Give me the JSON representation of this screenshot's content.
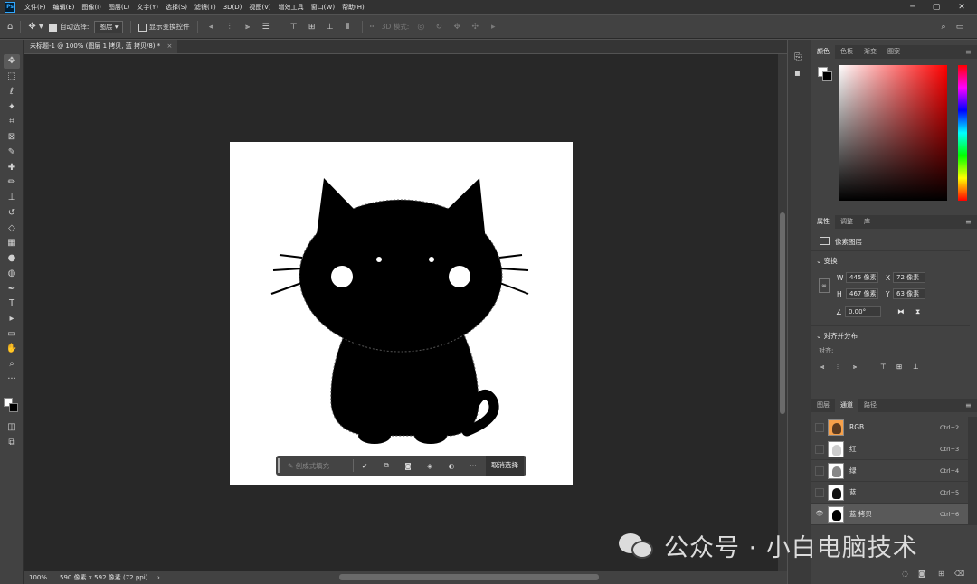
{
  "app": {
    "logo": "Ps",
    "menus": [
      "文件(F)",
      "编辑(E)",
      "图像(I)",
      "图层(L)",
      "文字(Y)",
      "选择(S)",
      "滤镜(T)",
      "3D(D)",
      "视图(V)",
      "增效工具",
      "窗口(W)",
      "帮助(H)"
    ]
  },
  "window": {
    "minimize": "─",
    "maximize": "▢",
    "close": "✕"
  },
  "options": {
    "auto_select_label": "自动选择:",
    "auto_select_value": "图层",
    "show_transform_label": "显示变换控件",
    "mode_3d_label": "3D 模式:",
    "more": "···"
  },
  "tools": {
    "move": "✥",
    "marquee": "⬚",
    "lasso": "ℓ",
    "wand": "✦",
    "crop": "⌗",
    "frame": "⊠",
    "eyedropper": "✎",
    "healing": "✚",
    "brush": "✏",
    "stamp": "⊥",
    "history": "↺",
    "eraser": "◇",
    "gradient": "▦",
    "blur": "●",
    "dodge": "◍",
    "pen": "✒",
    "type": "T",
    "path": "▸",
    "shape": "▭",
    "hand": "✋",
    "zoom": "⌕",
    "more": "···",
    "edit_quickmask": "◫",
    "screen_mode": "⧉"
  },
  "document": {
    "tab_title": "未标题-1 @ 100% (图层 1 拷贝, 蓝 拷贝/8) *",
    "tab_close": "×"
  },
  "contextbar": {
    "gen_fill": "创成式填充",
    "deselect": "取消选择",
    "more": "···"
  },
  "status": {
    "zoom": "100%",
    "info": "590 像素 x 592 像素 (72 ppi)",
    "arrow": "›"
  },
  "color_panel": {
    "tabs": [
      "颜色",
      "色板",
      "渐变",
      "图案"
    ],
    "hue_top": "#ff0000",
    "picked": "#e53525"
  },
  "properties": {
    "tabs": [
      "属性",
      "调整",
      "库"
    ],
    "layer_kind": "像素图层",
    "transform_title": "变换",
    "W": "445 像素",
    "X": "72 像素",
    "H": "467 像素",
    "Y": "63 像素",
    "angle": "0.00°",
    "align_title": "对齐并分布",
    "align_label": "对齐:",
    "labels": {
      "w": "W",
      "x": "X",
      "h": "H",
      "y": "Y"
    }
  },
  "channels": {
    "tabs": [
      "图层",
      "通道",
      "路径"
    ],
    "rows": [
      {
        "name": "RGB",
        "key": "Ctrl+2"
      },
      {
        "name": "红",
        "key": "Ctrl+3"
      },
      {
        "name": "绿",
        "key": "Ctrl+4"
      },
      {
        "name": "蓝",
        "key": "Ctrl+5"
      },
      {
        "name": "蓝 拷贝",
        "key": "Ctrl+6",
        "visible": "👁"
      }
    ]
  },
  "watermark": {
    "text": "公众号 · 小白电脑技术"
  }
}
